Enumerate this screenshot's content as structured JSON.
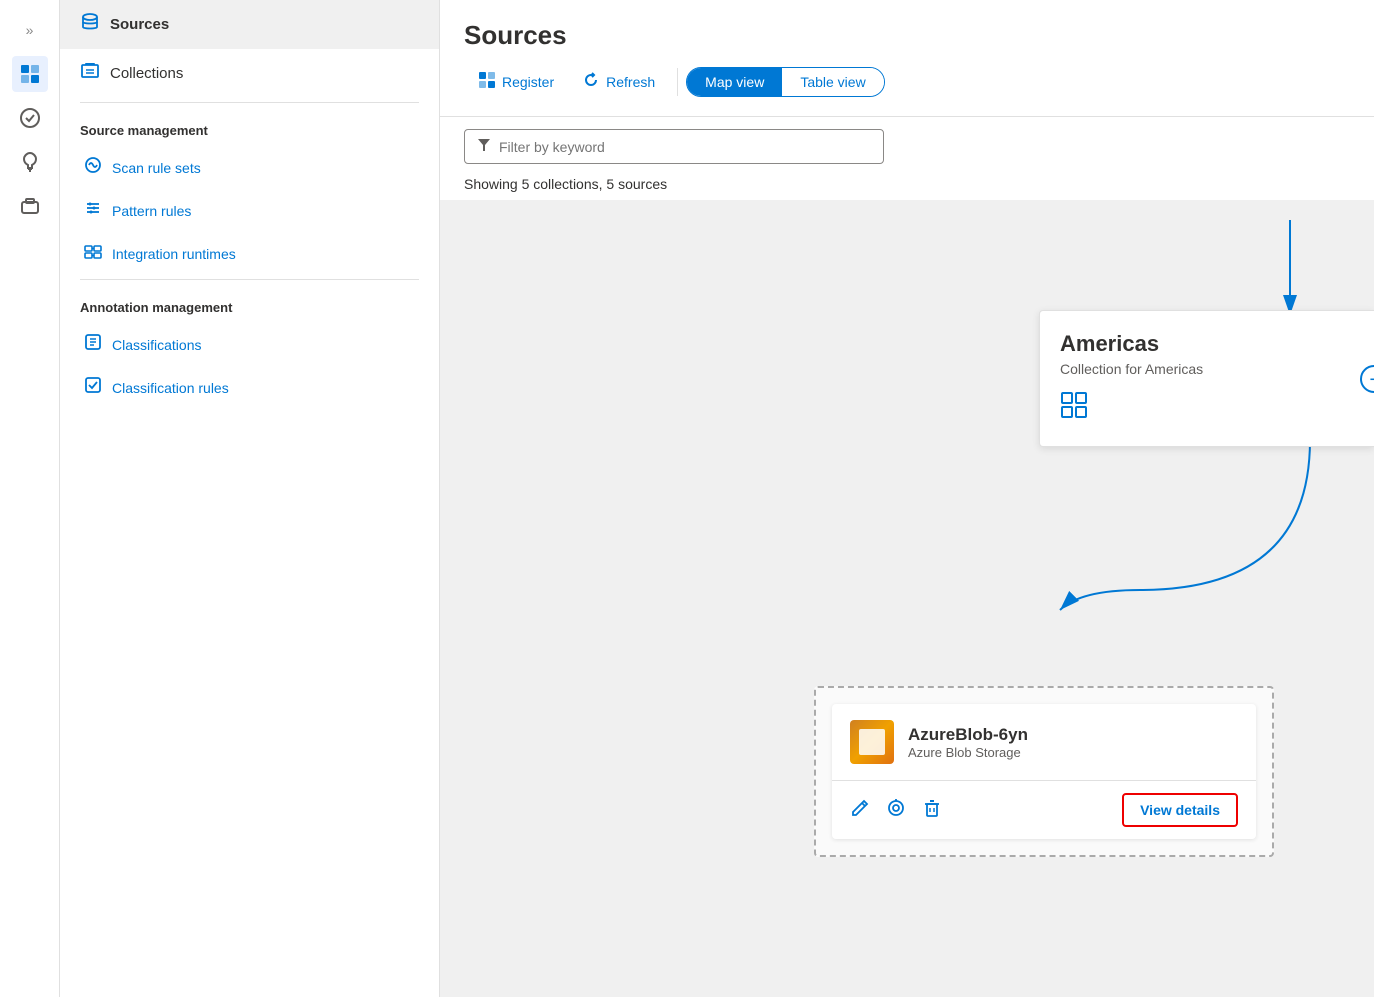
{
  "rail": {
    "chevron_icon": "»",
    "items": [
      {
        "id": "data-catalog",
        "icon": "🗂",
        "active": true
      },
      {
        "id": "workflow",
        "icon": "⚙",
        "active": false
      },
      {
        "id": "insights",
        "icon": "💡",
        "active": false
      },
      {
        "id": "tools",
        "icon": "🧰",
        "active": false
      }
    ]
  },
  "sidebar": {
    "sources_label": "Sources",
    "collections_label": "Collections",
    "source_management_label": "Source management",
    "scan_rule_sets_label": "Scan rule sets",
    "pattern_rules_label": "Pattern rules",
    "integration_runtimes_label": "Integration runtimes",
    "annotation_management_label": "Annotation management",
    "classifications_label": "Classifications",
    "classification_rules_label": "Classification rules"
  },
  "main": {
    "title": "Sources",
    "toolbar": {
      "register_label": "Register",
      "refresh_label": "Refresh",
      "map_view_label": "Map view",
      "table_view_label": "Table view"
    },
    "filter": {
      "placeholder": "Filter by keyword"
    },
    "showing_text": "Showing 5 collections, 5 sources"
  },
  "map": {
    "americas_card": {
      "title": "Americas",
      "subtitle": "Collection for Americas",
      "grid_icon": "⊞"
    },
    "azureblob_card": {
      "title": "AzureBlob-6yn",
      "subtitle": "Azure Blob Storage",
      "edit_icon": "✏",
      "scan_icon": "◎",
      "delete_icon": "🗑",
      "view_details_label": "View details"
    }
  }
}
